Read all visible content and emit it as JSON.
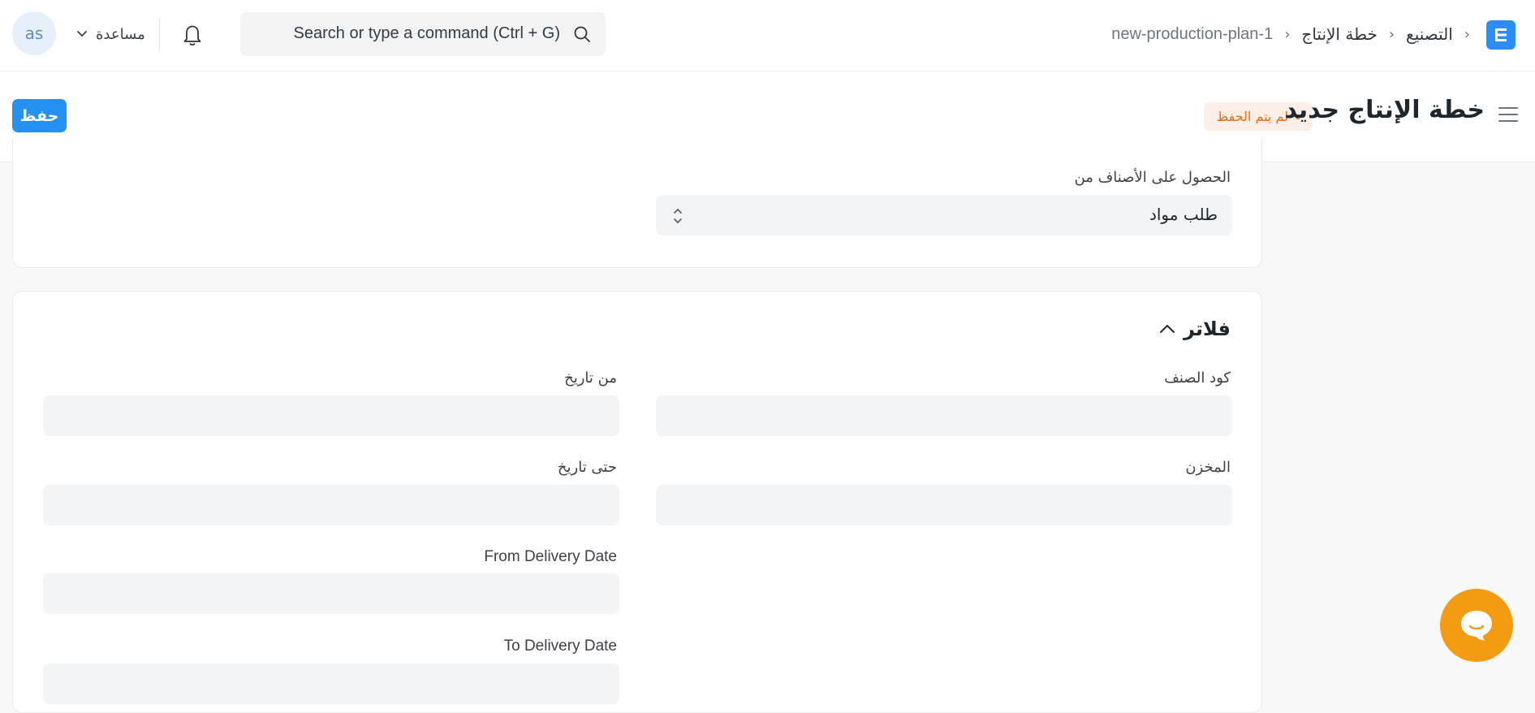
{
  "topbar": {
    "avatar_initials": "as",
    "help_label": "مساعدة",
    "search_placeholder": "Search or type a command (Ctrl + G)",
    "breadcrumbs": [
      "التصنيع",
      "خطة الإنتاج",
      "new-production-plan-1"
    ],
    "logo_letter": "E",
    "accent_color": "#2490ef"
  },
  "page": {
    "title": "خطة الإنتاج جديد",
    "status_badge": "لم يتم الحفظ",
    "save_label": "حفظ"
  },
  "form": {
    "get_items_from": {
      "label": "الحصول على الأصناف من",
      "value": "طلب مواد"
    },
    "filters_section": {
      "title": "فلاتر",
      "item_code_label": "كود الصنف",
      "from_date_label": "من تاريخ",
      "warehouse_label": "المخزن",
      "to_date_label": "حتى تاريخ",
      "from_delivery_date_label": "From Delivery Date",
      "to_delivery_date_label": "To Delivery Date"
    }
  },
  "chat": {
    "icon": "chat-bubble-icon",
    "color": "#f39c12"
  }
}
